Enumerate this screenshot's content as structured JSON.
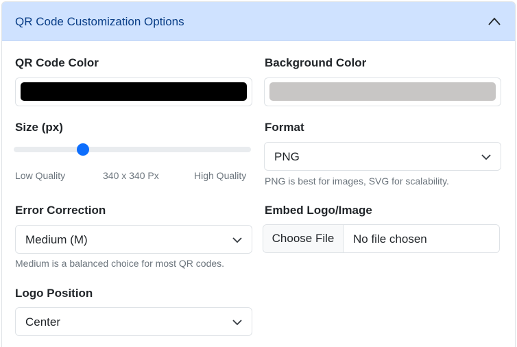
{
  "accordion": {
    "title": "QR Code Customization Options",
    "expanded": true
  },
  "qr_color": {
    "label": "QR Code Color",
    "value": "#000000"
  },
  "background_color": {
    "label": "Background Color",
    "value": "#c8c6c5"
  },
  "size": {
    "label": "Size (px)",
    "min_label": "Low Quality",
    "current_label": "340 x 340 Px",
    "max_label": "High Quality",
    "fraction": 0.28
  },
  "format": {
    "label": "Format",
    "selected": "PNG",
    "help": "PNG is best for images, SVG for scalability."
  },
  "error_correction": {
    "label": "Error Correction",
    "selected": "Medium (M)",
    "help": "Medium is a balanced choice for most QR codes."
  },
  "embed_logo": {
    "label": "Embed Logo/Image",
    "button_label": "Choose File",
    "status": "No file chosen"
  },
  "logo_position": {
    "label": "Logo Position",
    "selected": "Center"
  },
  "colors": {
    "accent": "#0d6efd",
    "header_bg": "#cfe2ff",
    "header_text": "#0a3e87"
  }
}
